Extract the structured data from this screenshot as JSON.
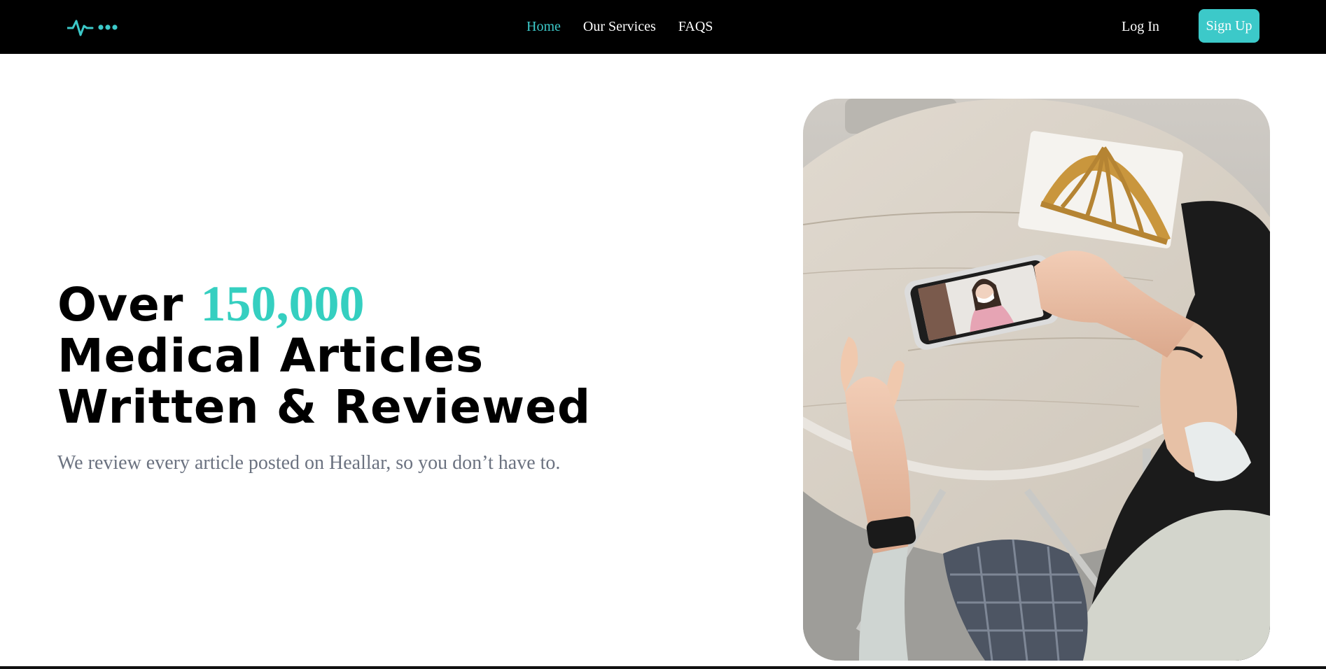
{
  "brand": {
    "logo_icon": "heartbeat-pulse-icon",
    "accent_color": "#3cc9c9"
  },
  "nav": {
    "links": [
      {
        "label": "Home",
        "active": true
      },
      {
        "label": "Our Services",
        "active": false
      },
      {
        "label": "FAQS",
        "active": false
      }
    ],
    "login_label": "Log In",
    "signup_label": "Sign Up"
  },
  "hero": {
    "title_prefix": "Over",
    "title_number": "150,000",
    "title_line2": "Medical Articles",
    "title_line3": "Written & Reviewed",
    "subtitle": "We review every article posted on Heallar, so you don’t have to.",
    "image": "photo-person-video-call-doctor-on-phone"
  }
}
